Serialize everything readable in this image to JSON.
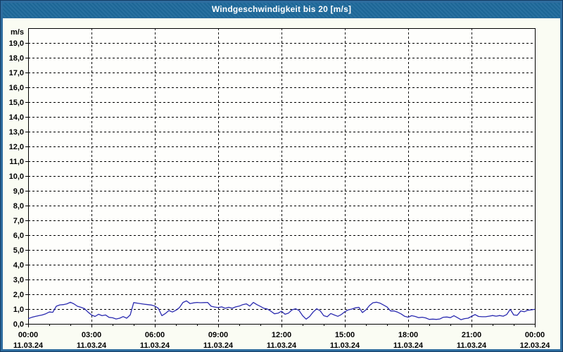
{
  "window": {
    "title": "Windgeschwindigkeit bis 20 [m/s]"
  },
  "colors": {
    "title_bar": "#1e699b",
    "title_text": "#ffffff",
    "frame_outer": "#143c64",
    "frame_inner": "#2e6d9f",
    "background": "#fafcf3",
    "plot_background": "#fefefc",
    "grid": "#000000",
    "axis": "#000000",
    "label_text": "#000000",
    "line": "#2b2bb0"
  },
  "chart_data": {
    "type": "line",
    "title": "Windgeschwindigkeit bis 20 [m/s]",
    "ylabel": "m/s",
    "ylim": [
      0,
      20
    ],
    "y_tick_interval": 1.0,
    "y_tick_labels": [
      "0,0",
      "1,0",
      "2,0",
      "3,0",
      "4,0",
      "5,0",
      "6,0",
      "7,0",
      "8,0",
      "9,0",
      "10,0",
      "11,0",
      "12,0",
      "13,0",
      "14,0",
      "15,0",
      "16,0",
      "17,0",
      "18,0",
      "19,0"
    ],
    "grid": "dashed",
    "legend": "none",
    "x_start_minutes": 0,
    "x_end_minutes": 1440,
    "x_step_minutes": 10,
    "x_minor_tick_minutes": 60,
    "x_major_tick_minutes": 180,
    "x_major_ticks": [
      {
        "time": "00:00",
        "date": "11.03.24"
      },
      {
        "time": "03:00",
        "date": "11.03.24"
      },
      {
        "time": "06:00",
        "date": "11.03.24"
      },
      {
        "time": "09:00",
        "date": "11.03.24"
      },
      {
        "time": "12:00",
        "date": "11.03.24"
      },
      {
        "time": "15:00",
        "date": "11.03.24"
      },
      {
        "time": "18:00",
        "date": "11.03.24"
      },
      {
        "time": "21:00",
        "date": "11.03.24"
      },
      {
        "time": "00:00",
        "date": "12.03.24"
      }
    ],
    "series": [
      {
        "name": "Windgeschwindigkeit [m/s]",
        "values": [
          0.35,
          0.44,
          0.5,
          0.55,
          0.6,
          0.68,
          0.8,
          0.78,
          1.19,
          1.28,
          1.3,
          1.35,
          1.46,
          1.35,
          1.19,
          1.12,
          1.03,
          0.8,
          0.6,
          0.5,
          0.65,
          0.55,
          0.6,
          0.44,
          0.41,
          0.33,
          0.38,
          0.49,
          0.38,
          0.6,
          1.44,
          1.4,
          1.36,
          1.33,
          1.3,
          1.27,
          1.2,
          1.05,
          0.55,
          0.7,
          0.9,
          0.8,
          0.92,
          1.1,
          1.45,
          1.55,
          1.37,
          1.42,
          1.45,
          1.43,
          1.44,
          1.45,
          1.19,
          1.14,
          1.1,
          1.15,
          1.05,
          1.12,
          1.05,
          1.15,
          1.2,
          1.3,
          1.35,
          1.2,
          1.45,
          1.3,
          1.18,
          1.05,
          1.0,
          0.85,
          0.68,
          0.72,
          0.85,
          0.65,
          0.73,
          0.95,
          1.02,
          0.9,
          0.55,
          0.32,
          0.5,
          0.8,
          1.02,
          0.88,
          0.55,
          0.48,
          0.7,
          0.6,
          0.51,
          0.63,
          0.82,
          0.95,
          1.0,
          1.08,
          1.12,
          0.76,
          0.95,
          1.24,
          1.43,
          1.46,
          1.4,
          1.27,
          1.14,
          0.87,
          0.87,
          0.79,
          0.67,
          0.51,
          0.45,
          0.55,
          0.5,
          0.42,
          0.45,
          0.4,
          0.3,
          0.32,
          0.3,
          0.33,
          0.45,
          0.46,
          0.42,
          0.55,
          0.42,
          0.28,
          0.35,
          0.38,
          0.5,
          0.63,
          0.5,
          0.48,
          0.48,
          0.52,
          0.56,
          0.52,
          0.56,
          0.52,
          0.63,
          0.98,
          0.6,
          0.58,
          0.87,
          0.82,
          0.92,
          0.95,
          0.98
        ]
      }
    ]
  }
}
